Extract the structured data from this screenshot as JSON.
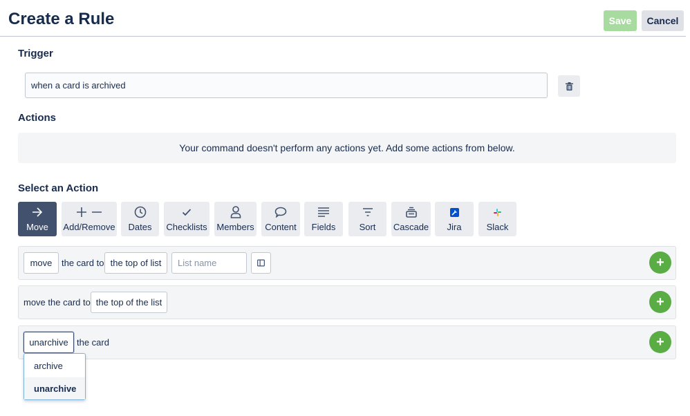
{
  "header": {
    "title": "Create a Rule",
    "save_label": "Save",
    "cancel_label": "Cancel"
  },
  "trigger": {
    "section_label": "Trigger",
    "value": "when a card is archived"
  },
  "actions": {
    "section_label": "Actions",
    "empty_text": "Your command doesn't perform any actions yet. Add some actions from below."
  },
  "select_action": {
    "section_label": "Select an Action",
    "tabs": [
      {
        "label": "Move",
        "icon": "arrow-right-icon",
        "active": true
      },
      {
        "label": "Add/Remove",
        "icon": "plus-minus-icon"
      },
      {
        "label": "Dates",
        "icon": "clock-icon"
      },
      {
        "label": "Checklists",
        "icon": "check-icon"
      },
      {
        "label": "Members",
        "icon": "person-icon"
      },
      {
        "label": "Content",
        "icon": "speech-bubble-icon"
      },
      {
        "label": "Fields",
        "icon": "lines-icon"
      },
      {
        "label": "Sort",
        "icon": "filter-icon"
      },
      {
        "label": "Cascade",
        "icon": "stack-icon"
      },
      {
        "label": "Jira",
        "icon": "jira-icon"
      },
      {
        "label": "Slack",
        "icon": "slack-icon"
      }
    ]
  },
  "rows": {
    "row1": {
      "verb": "move",
      "text1": "the card to",
      "position": "the top of list",
      "list_placeholder": "List name"
    },
    "row2": {
      "text1": "move the card to",
      "position": "the top of the list"
    },
    "row3": {
      "verb": "unarchive",
      "text1": "the card"
    }
  },
  "dropdown": {
    "options": [
      "archive",
      "unarchive"
    ],
    "selected": "unarchive"
  },
  "colors": {
    "accent_green": "#5aac44",
    "active_tab": "#42526e",
    "save_disabled": "#a8dba0"
  }
}
